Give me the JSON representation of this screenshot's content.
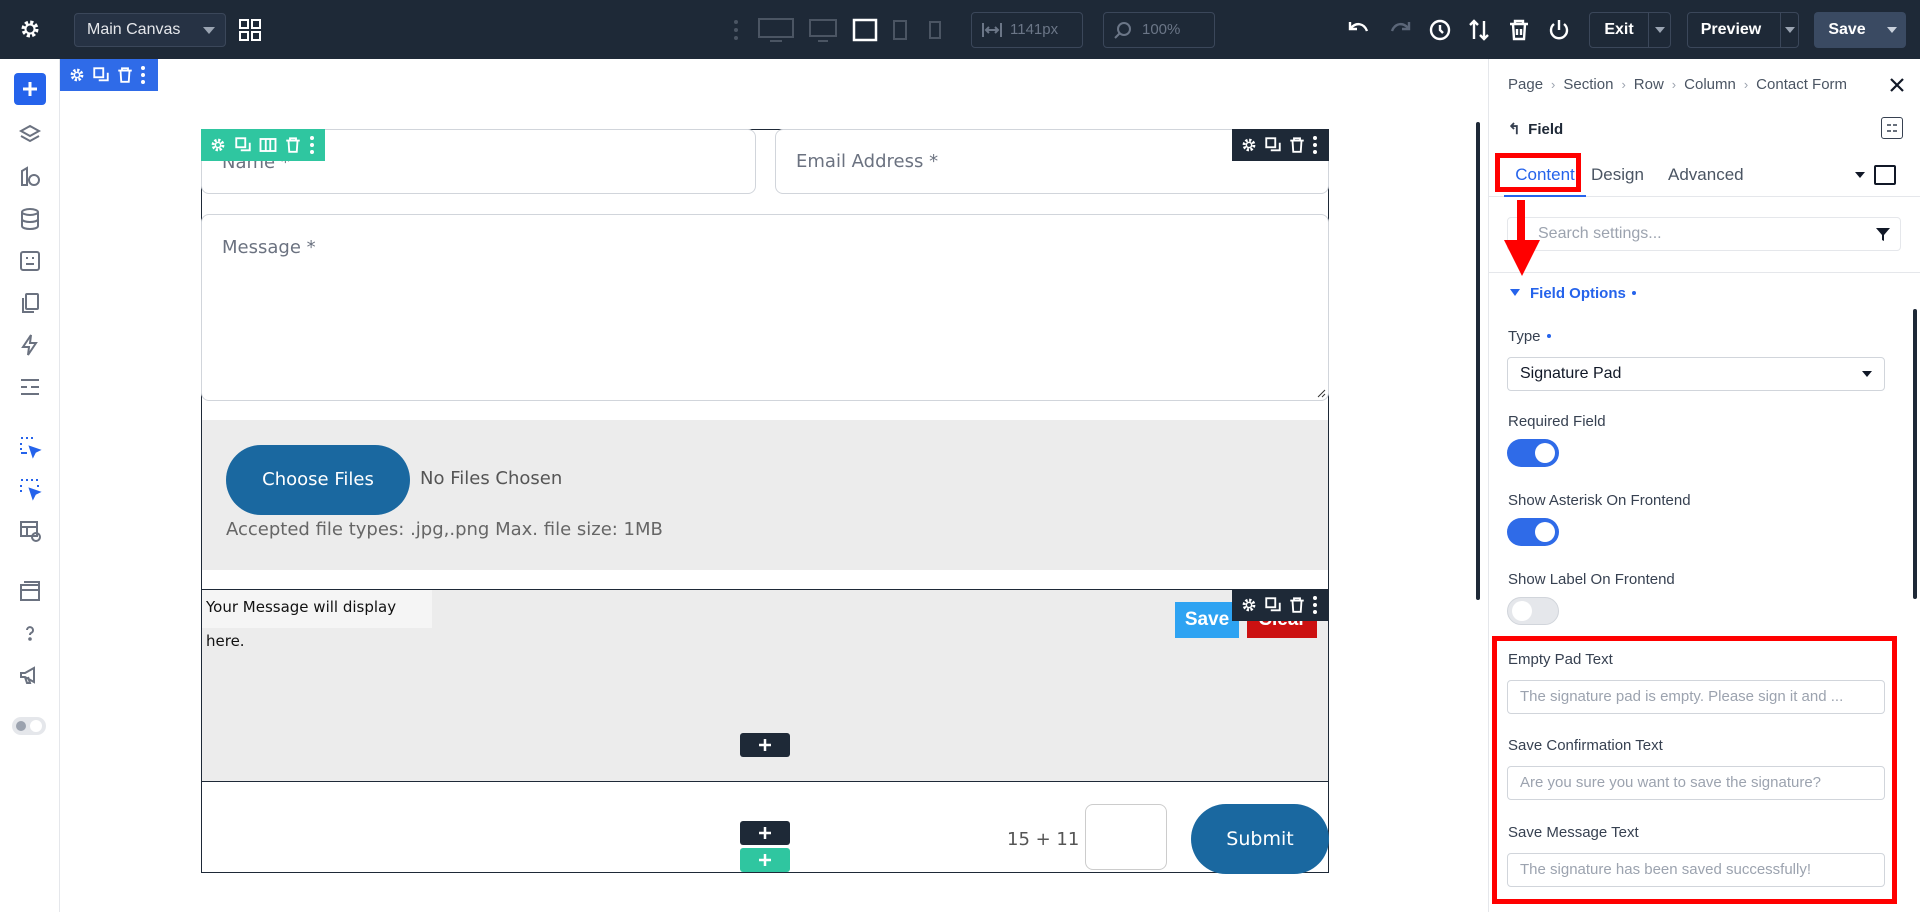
{
  "topbar": {
    "canvas_select": "Main Canvas",
    "width_value": "1141px",
    "zoom_value": "100%",
    "exit_label": "Exit",
    "preview_label": "Preview",
    "save_label": "Save"
  },
  "canvas": {
    "fields": {
      "name_placeholder": "Name *",
      "email_placeholder": "Email Address *",
      "message_placeholder": "Message *"
    },
    "upload": {
      "button_label": "Choose Files",
      "status": "No Files Chosen",
      "accepted": "Accepted file types: .jpg,.png Max. file size: 1MB"
    },
    "signature": {
      "message": "Your Message will display here.",
      "save_label": "Save",
      "clear_label": "Clear"
    },
    "captcha_question": "15 + 11 =",
    "submit_label": "Submit"
  },
  "panel": {
    "breadcrumbs": [
      "Page",
      "Section",
      "Row",
      "Column",
      "Contact Form"
    ],
    "module_title": "Field",
    "tabs": {
      "content": "Content",
      "design": "Design",
      "advanced": "Advanced"
    },
    "search_placeholder": "Search settings...",
    "group_title": "Field Options",
    "type_label": "Type",
    "type_value": "Signature Pad",
    "required_label": "Required Field",
    "asterisk_label": "Show Asterisk On Frontend",
    "show_label_label": "Show Label On Frontend",
    "empty_pad_label": "Empty Pad Text",
    "empty_pad_placeholder": "The signature pad is empty. Please sign it and ...",
    "save_confirm_label": "Save Confirmation Text",
    "save_confirm_placeholder": "Are you sure you want to save the signature?",
    "save_message_label": "Save Message Text",
    "save_message_placeholder": "The signature has been saved successfully!",
    "toggles": {
      "required": true,
      "show_asterisk": true,
      "show_label": false
    }
  },
  "colors": {
    "topbar_bg": "#1e2937",
    "accent": "#2563eb",
    "button_blue": "#1a68a0",
    "row_tools": "#2fc6a0",
    "annotation": "#ff0000"
  }
}
